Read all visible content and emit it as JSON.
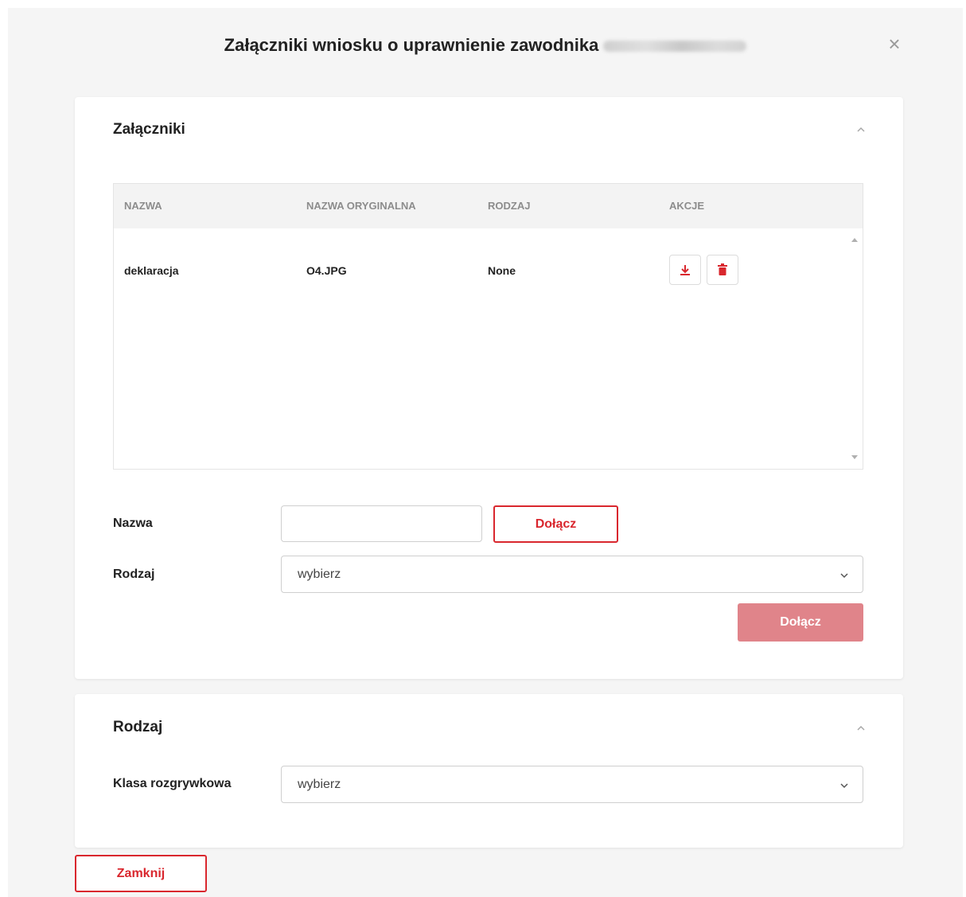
{
  "modal": {
    "title": "Załączniki wniosku o uprawnienie zawodnika",
    "close_symbol": "×"
  },
  "attachments_section": {
    "title": "Załączniki",
    "table": {
      "headers": [
        "NAZWA",
        "NAZWA ORYGINALNA",
        "RODZAJ",
        "AKCJE"
      ],
      "rows": [
        {
          "name": "deklaracja",
          "original_name": "O4.JPG",
          "type": "None",
          "actions": [
            "download-icon",
            "trash-icon"
          ]
        }
      ]
    },
    "name_label": "Nazwa",
    "name_value": "",
    "attach_button": "Dołącz",
    "type_label": "Rodzaj",
    "type_select_value": "wybierz",
    "submit_button": "Dołącz"
  },
  "type_section": {
    "title": "Rodzaj",
    "class_label": "Klasa rozgrywkowa",
    "class_select_value": "wybierz"
  },
  "footer": {
    "close_button": "Zamknij"
  },
  "colors": {
    "accent": "#d9272e",
    "accent_disabled": "#e0848a",
    "background": "#f5f5f5"
  }
}
